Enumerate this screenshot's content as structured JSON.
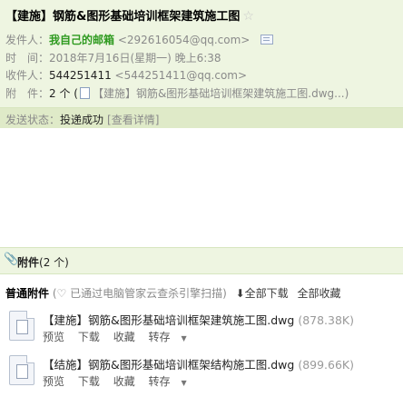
{
  "header": {
    "subject": "【建施】钢筋&图形基础培训框架建筑施工图",
    "star_icon": "star-icon",
    "from_label": "发件人：",
    "from_name": "我自己的邮箱",
    "from_email": "<292616054@qq.com>",
    "time_label": "时　间：",
    "time_value": "2018年7月16日(星期一) 晚上6:38",
    "to_label": "收件人：",
    "to_name": "544251411",
    "to_email": "<544251411@qq.com>",
    "attach_label": "附　件：",
    "attach_count": "2 个 (",
    "attach_preview": "【建施】钢筋&图形基础培训框架建筑施工图.dwg...)"
  },
  "status": {
    "label": "发送状态：",
    "value": "投递成功",
    "detail_link": "[查看详情]"
  },
  "attachments": {
    "title": "附件",
    "count": "(2 个)",
    "normal_label": "普通附件",
    "scan_note": "(♡ 已通过电脑管家云查杀引擎扫描)",
    "download_all": "全部下载",
    "save_all": "全部收藏",
    "files": [
      {
        "name": "【建施】钢筋&图形基础培训框架建筑施工图.dwg",
        "size": "(878.38K)",
        "actions": [
          "预览",
          "下载",
          "收藏",
          "转存"
        ]
      },
      {
        "name": "【结施】钢筋&图形基础培训框架结构施工图.dwg",
        "size": "(899.66K)",
        "actions": [
          "预览",
          "下载",
          "收藏",
          "转存"
        ]
      }
    ]
  },
  "colors": {
    "header_bg": "#eef5e1",
    "status_bg": "#dfeac8",
    "sender_green": "#2e9a1f",
    "link_blue": "#2a63b5"
  }
}
